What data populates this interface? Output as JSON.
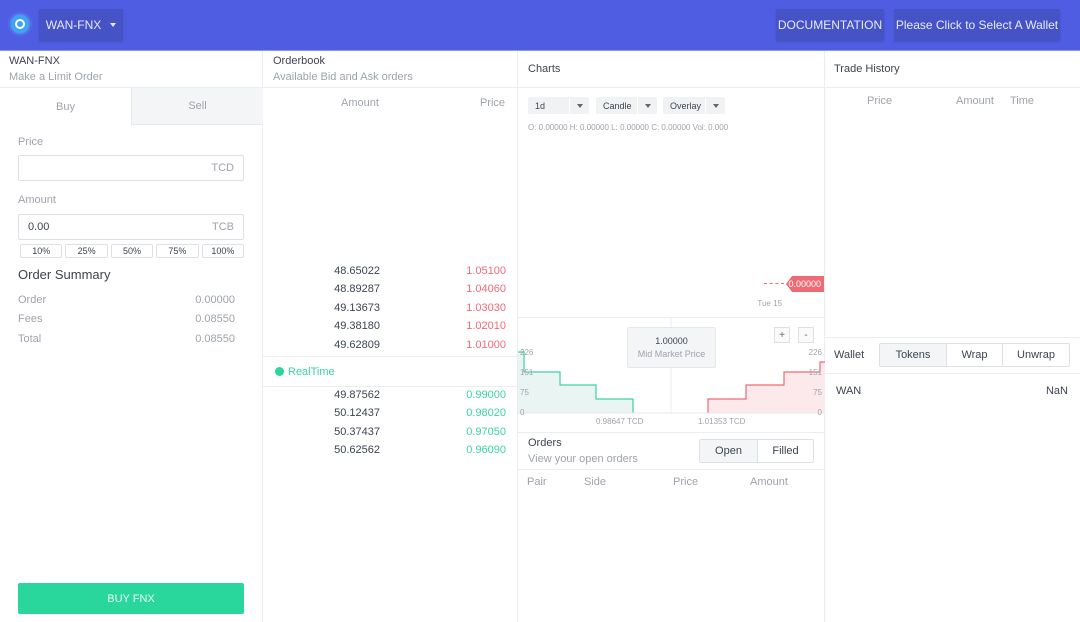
{
  "topbar": {
    "pair": "WAN-FNX",
    "documentation": "DOCUMENTATION",
    "wallet_button": "Please Click to Select A Wallet"
  },
  "order_form": {
    "title": "WAN-FNX",
    "subtitle": "Make a Limit Order",
    "tabs": [
      "Buy",
      "Sell"
    ],
    "price_label": "Price",
    "price_value": "",
    "price_unit": "TCD",
    "amount_label": "Amount",
    "amount_value": "0.00",
    "amount_unit": "TCB",
    "percentages": [
      "10%",
      "25%",
      "50%",
      "75%",
      "100%"
    ],
    "summary_title": "Order Summary",
    "summary": [
      {
        "k": "Order",
        "v": "0.00000"
      },
      {
        "k": "Fees",
        "v": "0.08550"
      },
      {
        "k": "Total",
        "v": "0.08550"
      }
    ],
    "submit": "BUY FNX"
  },
  "orderbook": {
    "title": "Orderbook",
    "subtitle": "Available Bid and Ask orders",
    "headers": {
      "amount": "Amount",
      "price": "Price"
    },
    "asks": [
      {
        "amount": "48.65022",
        "price": "1.05100"
      },
      {
        "amount": "48.89287",
        "price": "1.04060"
      },
      {
        "amount": "49.13673",
        "price": "1.03030"
      },
      {
        "amount": "49.38180",
        "price": "1.02010"
      },
      {
        "amount": "49.62809",
        "price": "1.01000"
      }
    ],
    "realtime": "RealTime",
    "bids": [
      {
        "amount": "49.87562",
        "price": "0.99000"
      },
      {
        "amount": "50.12437",
        "price": "0.98020"
      },
      {
        "amount": "50.37437",
        "price": "0.97050"
      },
      {
        "amount": "50.62562",
        "price": "0.96090"
      }
    ]
  },
  "charts": {
    "title": "Charts",
    "interval": "1d",
    "type": "Candle",
    "overlay": "Overlay",
    "ohlc": "O: 0.00000  H: 0.00000  L: 0.00000  C: 0.00000  Vol: 0.000",
    "last_price": "0.00000",
    "date": "Tue 15",
    "depth": {
      "mid_price": "1.00000",
      "mid_label": "Mid Market Price",
      "zoom_in": "+",
      "zoom_out": "-",
      "y_ticks": [
        "226",
        "151",
        "75",
        "0"
      ],
      "bid_label": "0.98647 TCD",
      "ask_label": "1.01353 TCD"
    }
  },
  "orders": {
    "title": "Orders",
    "subtitle": "View your open orders",
    "tabs": [
      "Open",
      "Filled"
    ],
    "headers": [
      "Pair",
      "Side",
      "Price",
      "Amount"
    ]
  },
  "trade_history": {
    "title": "Trade History",
    "headers": [
      "Price",
      "Amount",
      "Time"
    ]
  },
  "wallet": {
    "label": "Wallet",
    "tabs": [
      "Tokens",
      "Wrap",
      "Unwrap"
    ],
    "rows": [
      {
        "token": "WAN",
        "balance": "NaN"
      }
    ]
  }
}
